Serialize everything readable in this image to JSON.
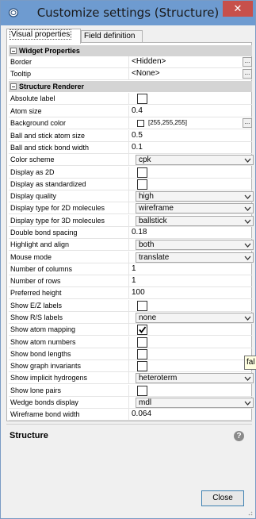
{
  "window": {
    "title": "Customize settings (Structure)",
    "close_glyph": "✕"
  },
  "tabs": [
    {
      "label": "Visual properties",
      "active": true
    },
    {
      "label": "Field definition",
      "active": false
    }
  ],
  "sections": {
    "widget": {
      "title": "Widget Properties",
      "rows": {
        "border": {
          "label": "Border",
          "value": "<Hidden>"
        },
        "tooltip": {
          "label": "Tooltip",
          "value": "<None>"
        }
      }
    },
    "renderer": {
      "title": "Structure Renderer",
      "rows": {
        "absolute_label": {
          "label": "Absolute label",
          "checked": false
        },
        "atom_size": {
          "label": "Atom size",
          "value": "0.4"
        },
        "background_color": {
          "label": "Background color",
          "value": "[255,255,255]",
          "color": "#ffffff"
        },
        "ball_stick_atom_size": {
          "label": "Ball and stick atom size",
          "value": "0.5"
        },
        "ball_stick_bond_width": {
          "label": "Ball and stick bond width",
          "value": "0.1"
        },
        "color_scheme": {
          "label": "Color scheme",
          "value": "cpk"
        },
        "display_2d": {
          "label": "Display as 2D",
          "checked": false
        },
        "display_standardized": {
          "label": "Display as standardized",
          "checked": false
        },
        "display_quality": {
          "label": "Display quality",
          "value": "high"
        },
        "display_2d_type": {
          "label": "Display type for 2D molecules",
          "value": "wireframe"
        },
        "display_3d_type": {
          "label": "Display type for 3D molecules",
          "value": "ballstick"
        },
        "double_bond_spacing": {
          "label": "Double bond spacing",
          "value": "0.18"
        },
        "highlight_align": {
          "label": "Highlight and align",
          "value": "both"
        },
        "mouse_mode": {
          "label": "Mouse mode",
          "value": "translate"
        },
        "num_columns": {
          "label": "Number of columns",
          "value": "1"
        },
        "num_rows": {
          "label": "Number of rows",
          "value": "1"
        },
        "preferred_height": {
          "label": "Preferred height",
          "value": "100"
        },
        "show_ez": {
          "label": "Show E/Z labels",
          "checked": false
        },
        "show_rs": {
          "label": "Show R/S labels",
          "value": "none"
        },
        "show_atom_mapping": {
          "label": "Show atom mapping",
          "checked": true
        },
        "show_atom_numbers": {
          "label": "Show atom numbers",
          "checked": false
        },
        "show_bond_lengths": {
          "label": "Show bond lengths",
          "checked": false
        },
        "show_graph_invariants": {
          "label": "Show graph invariants",
          "checked": false
        },
        "show_implicit_h": {
          "label": "Show implicit hydrogens",
          "value": "heteroterm"
        },
        "show_lone_pairs": {
          "label": "Show lone pairs",
          "checked": false
        },
        "wedge_bonds": {
          "label": "Wedge bonds display",
          "value": "mdl"
        },
        "wireframe_bond_width": {
          "label": "Wireframe bond width",
          "value": "0.064"
        }
      }
    }
  },
  "description": {
    "title": "Structure",
    "help_glyph": "?"
  },
  "tooltip_text": "fal",
  "buttons": {
    "close_label": "Close",
    "ellipsis": "..."
  },
  "colors": {
    "titlebar": "#6e9bd0",
    "close": "#c7504b",
    "section_bg": "#d4d4d4"
  }
}
